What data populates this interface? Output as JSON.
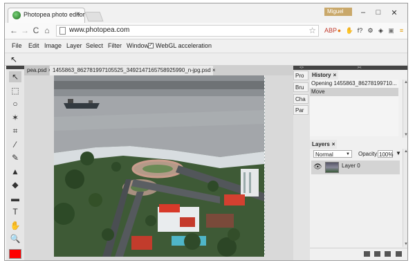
{
  "browser": {
    "tab_title": "Photopea photo editor",
    "tab_close": "×",
    "user_badge": "Miguel",
    "window_buttons": {
      "minimize": "–",
      "maximize": "□",
      "close": "✕"
    },
    "nav": {
      "back": "←",
      "forward": "→",
      "reload": "C",
      "home": "⌂"
    },
    "url": "www.photopea.com",
    "star": "☆",
    "extensions": [
      {
        "name": "adblock-icon",
        "label": "ABP",
        "color": "#c0392b"
      },
      {
        "name": "cookie-icon",
        "label": "●",
        "color": "#e67e22"
      },
      {
        "name": "hand-icon",
        "label": "✋",
        "color": "#333"
      },
      {
        "name": "formula-icon",
        "label": "f?",
        "color": "#333"
      },
      {
        "name": "gear-icon",
        "label": "⚙",
        "color": "#333"
      },
      {
        "name": "layers-icon",
        "label": "◈",
        "color": "#333"
      },
      {
        "name": "puzzle-icon",
        "label": "▣",
        "color": "#777"
      },
      {
        "name": "menu-icon",
        "label": "≡",
        "color": "#e09a00"
      }
    ]
  },
  "menu": {
    "items": [
      "File",
      "Edit",
      "Image",
      "Layer",
      "Select",
      "Filter",
      "Window"
    ],
    "webgl_label": "WebGL acceleration",
    "webgl_checked": "✓"
  },
  "tools": [
    {
      "name": "move-tool-icon",
      "glyph": "↖"
    },
    {
      "name": "marquee-tool-icon",
      "glyph": "⬚"
    },
    {
      "name": "lasso-tool-icon",
      "glyph": "○"
    },
    {
      "name": "magic-wand-tool-icon",
      "glyph": "✶"
    },
    {
      "name": "crop-tool-icon",
      "glyph": "⌗"
    },
    {
      "name": "eyedropper-tool-icon",
      "glyph": "⁄"
    },
    {
      "name": "brush-tool-icon",
      "glyph": "✎"
    },
    {
      "name": "stamp-tool-icon",
      "glyph": "▲"
    },
    {
      "name": "eraser-tool-icon",
      "glyph": "◆"
    },
    {
      "name": "gradient-tool-icon",
      "glyph": "▬"
    },
    {
      "name": "type-tool-icon",
      "glyph": "T"
    },
    {
      "name": "hand-tool-icon",
      "glyph": "✋"
    },
    {
      "name": "zoom-tool-icon",
      "glyph": "🔍"
    }
  ],
  "document_tabs": [
    {
      "label": "pea.psd",
      "close": "×"
    },
    {
      "label": "1455863_862781997105525_3492147165758925990_n-jpg.psd",
      "close": "×"
    }
  ],
  "collapsed_panels": [
    "Pro",
    "Bru",
    "Cha",
    "Par"
  ],
  "panel_strip": {
    "left": "<>",
    "right": "><"
  },
  "history": {
    "title": "History",
    "close": "×",
    "items": [
      {
        "label": "Opening 1455863_86278199710...",
        "selected": false
      },
      {
        "label": "Move",
        "selected": true
      }
    ]
  },
  "layers": {
    "title": "Layers",
    "close": "×",
    "blend_mode": "Normal",
    "opacity_label": "Opacity:",
    "opacity_value": "100%",
    "items": [
      {
        "name": "Layer 0",
        "visible": true
      }
    ]
  },
  "colors": {
    "foreground": "#ff0000",
    "panel_dark": "#444444"
  }
}
